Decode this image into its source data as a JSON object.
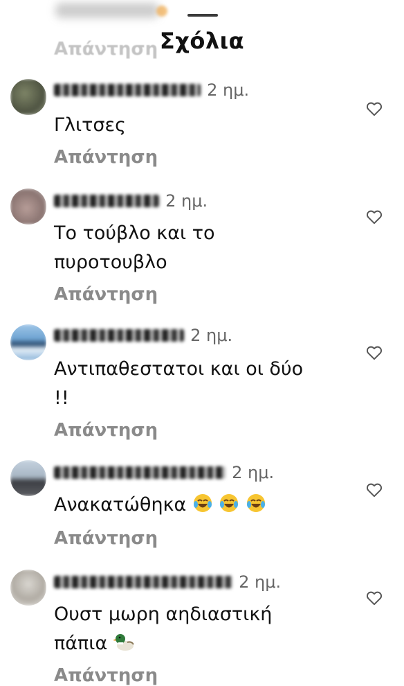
{
  "sheet": {
    "title": "Σχόλια",
    "peek_reply": "Απάντηση"
  },
  "comments": [
    {
      "time": "2 ημ.",
      "text": "Γλιτσες",
      "reply": "Απάντηση"
    },
    {
      "time": "2 ημ.",
      "text_lines": [
        "Το τούβλο και το",
        "πυροτουβλο"
      ],
      "reply": "Απάντηση"
    },
    {
      "time": "2 ημ.",
      "text_lines": [
        "Αντιπαθεστατοι και οι δύο",
        "!!"
      ],
      "reply": "Απάντηση"
    },
    {
      "time": "2 ημ.",
      "text": "Ανακατώθηκα",
      "reply": "Απάντηση",
      "emojis": [
        "laughing-tears-emoji",
        "laughing-tears-emoji",
        "laughing-tears-emoji"
      ]
    },
    {
      "time": "2 ημ.",
      "text_lines": [
        "Ουστ μωρη αηδιαστική",
        "πάπια"
      ],
      "reply": "Απάντηση",
      "emojis": [
        "duck-emoji"
      ]
    }
  ]
}
